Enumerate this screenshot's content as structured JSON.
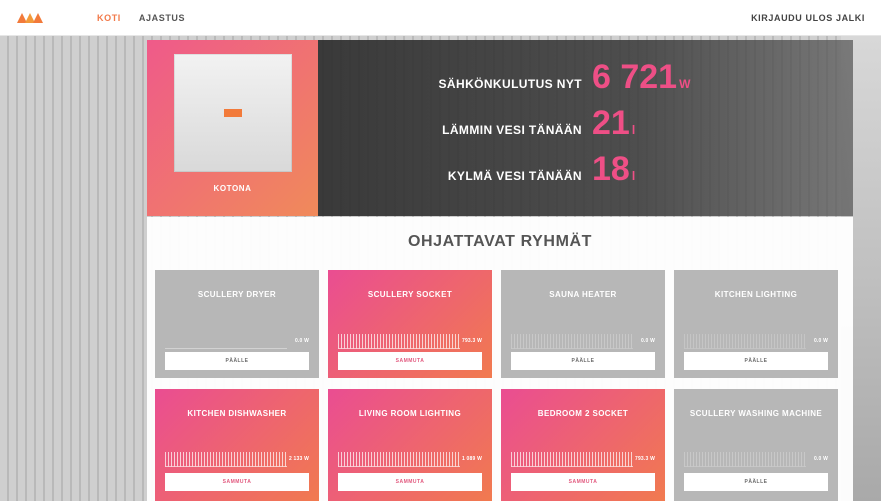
{
  "topbar": {
    "logo_text": "",
    "nav": [
      {
        "label": "KOTI"
      },
      {
        "label": "AJASTUS"
      }
    ],
    "logout": "KIRJAUDU ULOS JALKI"
  },
  "home": {
    "label": "KOTONA"
  },
  "stats": [
    {
      "label": "SÄHKÖNKULUTUS NYT",
      "value": "6 721",
      "unit": "W"
    },
    {
      "label": "LÄMMIN VESI TÄNÄÄN",
      "value": "21",
      "unit": "l"
    },
    {
      "label": "KYLMÄ VESI TÄNÄÄN",
      "value": "18",
      "unit": "l"
    }
  ],
  "groups": {
    "title": "OHJATTAVAT RYHMÄT",
    "cards": [
      {
        "title": "SCULLERY DRYER",
        "value": "0.0 W",
        "button": "PÄÄLLE",
        "state": "off"
      },
      {
        "title": "SCULLERY SOCKET",
        "value": "793.3 W",
        "button": "SAMMUTA",
        "state": "on"
      },
      {
        "title": "SAUNA HEATER",
        "value": "0.0 W",
        "button": "PÄÄLLE",
        "state": "off"
      },
      {
        "title": "KITCHEN LIGHTING",
        "value": "0.0 W",
        "button": "PÄÄLLE",
        "state": "off"
      },
      {
        "title": "KITCHEN DISHWASHER",
        "value": "2 133 W",
        "button": "SAMMUTA",
        "state": "on"
      },
      {
        "title": "LIVING ROOM LIGHTING",
        "value": "1 089 W",
        "button": "SAMMUTA",
        "state": "on"
      },
      {
        "title": "BEDROOM 2 SOCKET",
        "value": "793.3 W",
        "button": "SAMMUTA",
        "state": "on"
      },
      {
        "title": "SCULLERY WASHING MACHINE",
        "value": "0.0 W",
        "button": "PÄÄLLE",
        "state": "off"
      }
    ]
  },
  "colors": {
    "accent_pink": "#ee4f86",
    "accent_orange": "#f17a4f",
    "inactive_gray": "#b7b7b7"
  }
}
